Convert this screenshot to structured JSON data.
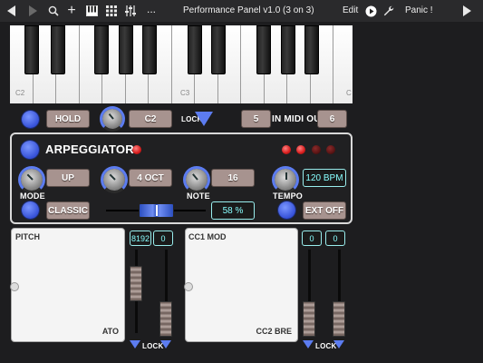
{
  "toolbar": {
    "title": "Performance Panel v1.0  (3 on 3)",
    "edit_label": "Edit",
    "panic_label": "Panic !",
    "more_label": "..."
  },
  "keyboard": {
    "labels": [
      "C2",
      "C3",
      "C"
    ]
  },
  "controls_row": {
    "hold_label": "HOLD",
    "octave_value": "C2",
    "lock_label": "LOCK",
    "midi_in_value": "5",
    "midi_label": "IN MIDI OUT",
    "midi_out_value": "6"
  },
  "arpeggiator": {
    "title": "ARPEGGIATOR",
    "mode_label": "MODE",
    "mode_value": "UP",
    "range_value": "4 OCT",
    "note_label": "NOTE",
    "note_value": "16",
    "tempo_label": "TEMPO",
    "tempo_value": "120 BPM",
    "style_value": "CLASSIC",
    "gate_value": "58 %",
    "sync_value": "EXT OFF"
  },
  "pad_left": {
    "title": "PITCH",
    "x_value": "8192",
    "y_value": "0",
    "footer": "ATO",
    "lock_label": "LOCK"
  },
  "pad_right": {
    "title": "CC1 MOD",
    "x_value": "0",
    "y_value": "0",
    "footer": "CC2 BRE",
    "lock_label": "LOCK"
  },
  "colors": {
    "accent": "#5c7cf0",
    "teal": "#8ff",
    "pill": "#a7938f",
    "led_on": "#e62020"
  }
}
